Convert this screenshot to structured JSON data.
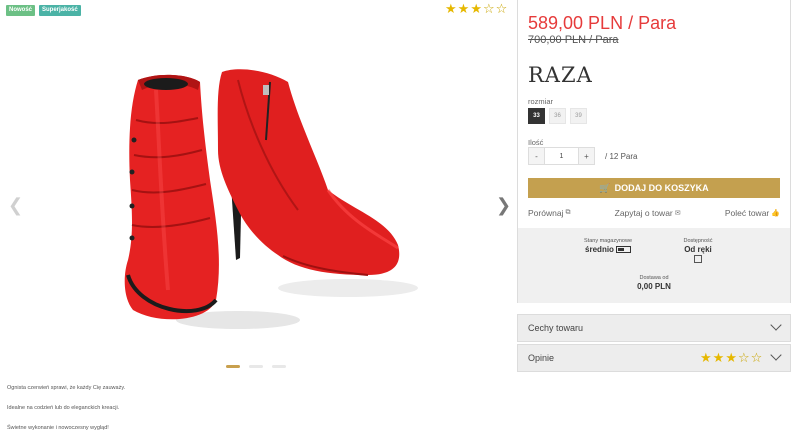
{
  "badges": {
    "new": "Nowość",
    "quality": "Superjakość"
  },
  "rating": {
    "filled": 3,
    "total": 5
  },
  "description": [
    "Ognista czerwień sprawi, że każdy Cię zauważy.",
    "Idealne na codzień lub do eleganckich kreacji.",
    "Świetne wykonanie i nowoczesny wygląd!"
  ],
  "gallery": {
    "slides": 3,
    "active": 0,
    "prev_icon": "chevron-left-icon",
    "next_icon": "chevron-right-icon"
  },
  "product": {
    "price": "589,00 PLN / Para",
    "old_price": "700,00 PLN / Para",
    "brand": "RAZA",
    "size_label": "rozmiar",
    "sizes": [
      "33",
      "36",
      "39"
    ],
    "selected_size": "33",
    "qty_label": "Ilość",
    "qty_minus": "-",
    "qty_value": "1",
    "qty_plus": "+",
    "qty_max": "/ 12 Para",
    "add_to_cart": "DODAJ DO KOSZYKA",
    "compare": "Porównaj",
    "ask": "Zapytaj o towar",
    "recommend": "Poleć towar"
  },
  "stock": {
    "stock_title": "Stany magazynowe",
    "stock_value": "średnio",
    "availability_title": "Dostępność",
    "availability_value": "Od ręki",
    "delivery_title": "Dostawa od",
    "delivery_value": "0,00 PLN"
  },
  "accordions": {
    "features": "Cechy towaru",
    "reviews": "Opinie"
  },
  "colors": {
    "accent": "#c4a04f",
    "price": "#e63b3b",
    "star": "#e6b800"
  }
}
